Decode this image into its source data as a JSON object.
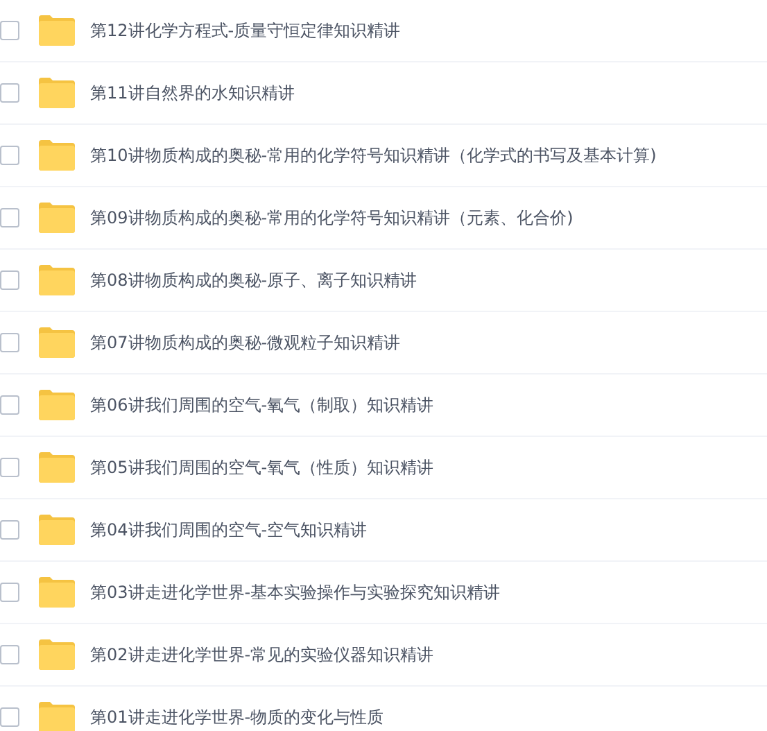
{
  "files": [
    {
      "name": "第12讲化学方程式-质量守恒定律知识精讲",
      "checked": false
    },
    {
      "name": "第11讲自然界的水知识精讲",
      "checked": false
    },
    {
      "name": "第10讲物质构成的奥秘-常用的化学符号知识精讲（化学式的书写及基本计算)",
      "checked": false
    },
    {
      "name": "第09讲物质构成的奥秘-常用的化学符号知识精讲（元素、化合价)",
      "checked": false
    },
    {
      "name": "第08讲物质构成的奥秘-原子、离子知识精讲",
      "checked": false
    },
    {
      "name": "第07讲物质构成的奥秘-微观粒子知识精讲",
      "checked": false
    },
    {
      "name": "第06讲我们周围的空气-氧气（制取）知识精讲",
      "checked": false
    },
    {
      "name": "第05讲我们周围的空气-氧气（性质）知识精讲",
      "checked": false
    },
    {
      "name": "第04讲我们周围的空气-空气知识精讲",
      "checked": false
    },
    {
      "name": "第03讲走进化学世界-基本实验操作与实验探究知识精讲",
      "checked": false
    },
    {
      "name": "第02讲走进化学世界-常见的实验仪器知识精讲",
      "checked": false
    },
    {
      "name": "第01讲走进化学世界-物质的变化与性质",
      "checked": false
    }
  ]
}
